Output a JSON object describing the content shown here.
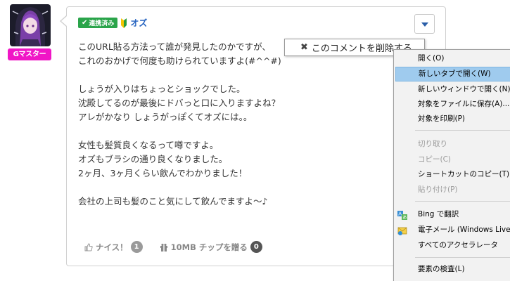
{
  "user": {
    "rank_badge": "Gマスター",
    "linked_label": "連携済み",
    "username": "オズ"
  },
  "comment": {
    "lines": [
      "このURL貼る方法って誰が発見したのかですが、",
      "これのおかげで何度も助けられていますよ(#^^#)",
      "",
      "しょうが入りはちょっとショックでした。",
      "沈殿してるのが最後にドバっと口に入りますよね？",
      "アレがかなり しょうがっぽくてオズには。。",
      "",
      "女性も髪質良くなるって噂ですよ。",
      "オズもブラシの通り良くなりました。",
      "2ヶ月、3ヶ月くらい飲んでわかりました！",
      "",
      "会社の上司も髪のこと気にして飲んでますよ〜♪"
    ]
  },
  "actions": {
    "nice_label": "ナイス！",
    "nice_count": "1",
    "chip_label": "10MB チップを贈る",
    "chip_count": "0"
  },
  "delete_popup": {
    "label": "このコメントを削除する"
  },
  "context_menu": {
    "items": [
      {
        "label": "開く(O)",
        "enabled": true
      },
      {
        "label": "新しいタブで開く(W)",
        "enabled": true,
        "highlighted": true
      },
      {
        "label": "新しいウィンドウで開く(N)",
        "enabled": true
      },
      {
        "label": "対象をファイルに保存(A)...",
        "enabled": true
      },
      {
        "label": "対象を印刷(P)",
        "enabled": true
      },
      {
        "label": "切り取り",
        "enabled": false
      },
      {
        "label": "コピー(C)",
        "enabled": false
      },
      {
        "label": "ショートカットのコピー(T)",
        "enabled": true
      },
      {
        "label": "貼り付け(P)",
        "enabled": false
      },
      {
        "label": "Bing で翻訳",
        "enabled": true,
        "icon": "translate-icon"
      },
      {
        "label": "電子メール (Windows Live",
        "enabled": true,
        "icon": "email-icon"
      },
      {
        "label": "すべてのアクセラレータ",
        "enabled": true
      },
      {
        "label": "要素の検査(L)",
        "enabled": true
      }
    ]
  },
  "colors": {
    "rank_badge": "#f016c6",
    "linked_badge": "#2aa44a",
    "username": "#2563c0",
    "menu_highlight": "#9fcbee"
  }
}
